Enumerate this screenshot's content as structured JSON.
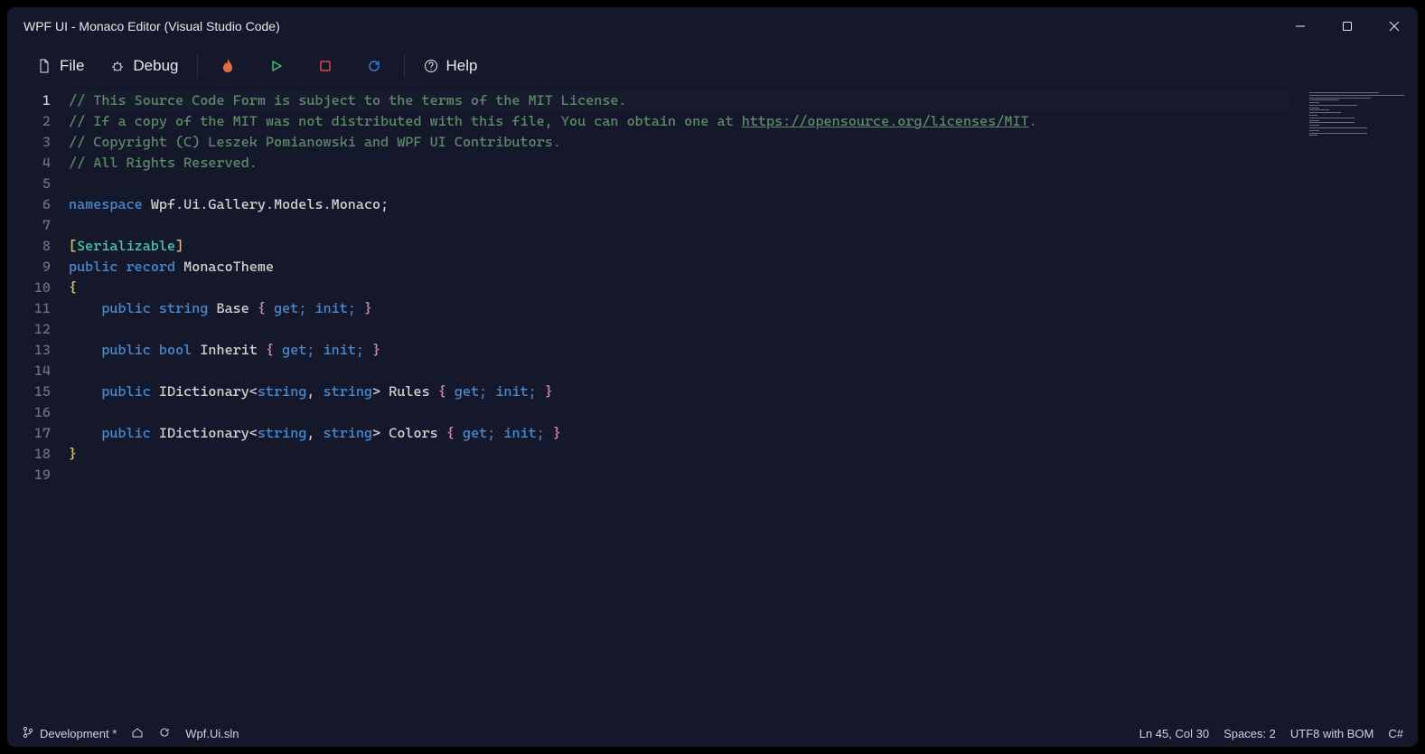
{
  "window": {
    "title": "WPF UI - Monaco Editor (Visual Studio Code)"
  },
  "toolbar": {
    "file_label": "File",
    "debug_label": "Debug",
    "help_label": "Help"
  },
  "editor": {
    "line_count": 19,
    "current_line": 1,
    "code_lines": [
      {
        "type": "comment",
        "text": "// This Source Code Form is subject to the terms of the MIT License."
      },
      {
        "type": "comment_with_link",
        "pre": "// If a copy of the MIT was not distributed with this file, You can obtain one at ",
        "link": "https://opensource.org/licenses/MIT",
        "post": "."
      },
      {
        "type": "comment",
        "text": "// Copyright (C) Leszek Pomianowski and WPF UI Contributors."
      },
      {
        "type": "comment",
        "text": "// All Rights Reserved."
      },
      {
        "type": "blank"
      },
      {
        "type": "namespace",
        "keyword": "namespace",
        "name": " Wpf.Ui.Gallery.Models.Monaco",
        "tail": ";"
      },
      {
        "type": "blank"
      },
      {
        "type": "attr",
        "open": "[",
        "name": "Serializable",
        "close": "]"
      },
      {
        "type": "record",
        "mods": "public",
        "kw": " record",
        "name": " MonacoTheme"
      },
      {
        "type": "brace_open",
        "text": "{"
      },
      {
        "type": "prop",
        "indent": "    ",
        "mods": "public",
        "ptype": " string",
        "name": " Base ",
        "open": "{",
        "acc": " get; init; ",
        "close": "}"
      },
      {
        "type": "blank"
      },
      {
        "type": "prop",
        "indent": "    ",
        "mods": "public",
        "ptype": " bool",
        "name": " Inherit ",
        "open": "{",
        "acc": " get; init; ",
        "close": "}"
      },
      {
        "type": "blank"
      },
      {
        "type": "prop_generic",
        "indent": "    ",
        "mods": "public",
        "ptype": " IDictionary",
        "lt": "<",
        "ga": "string",
        "comma": ", ",
        "gb": "string",
        "gt": ">",
        "name": " Rules ",
        "open": "{",
        "acc": " get; init; ",
        "close": "}"
      },
      {
        "type": "blank"
      },
      {
        "type": "prop_generic",
        "indent": "    ",
        "mods": "public",
        "ptype": " IDictionary",
        "lt": "<",
        "ga": "string",
        "comma": ", ",
        "gb": "string",
        "gt": ">",
        "name": " Colors ",
        "open": "{",
        "acc": " get; init; ",
        "close": "}"
      },
      {
        "type": "brace_close",
        "text": "}"
      },
      {
        "type": "blank"
      }
    ]
  },
  "status": {
    "branch": "Development *",
    "solution": "Wpf.Ui.sln",
    "cursor": "Ln 45, Col 30",
    "spaces": "Spaces: 2",
    "encoding": "UTF8 with BOM",
    "lang": "C#"
  }
}
